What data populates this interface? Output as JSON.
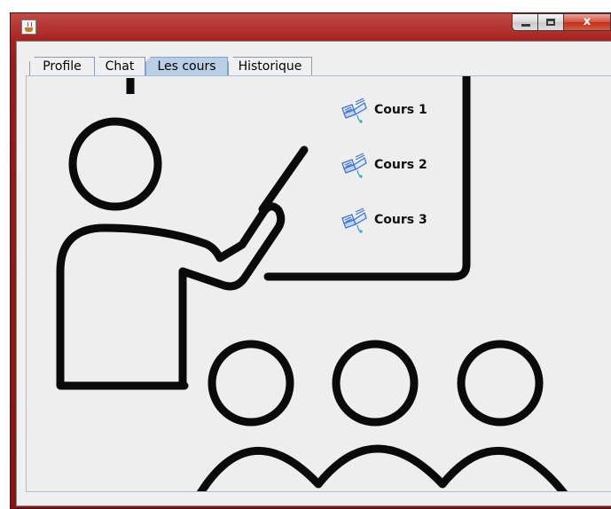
{
  "window": {
    "icon": "java-cup-icon",
    "buttons": [
      "minimize-icon",
      "maximize-icon",
      "close-icon"
    ],
    "close_glyph": "x"
  },
  "tabs": [
    {
      "label": "Profile",
      "selected": false
    },
    {
      "label": "Chat",
      "selected": false
    },
    {
      "label": "Les cours",
      "selected": true
    },
    {
      "label": "Historique",
      "selected": false
    }
  ],
  "courses": [
    {
      "label": "Cours 1",
      "icon": "open-book-icon"
    },
    {
      "label": "Cours 2",
      "icon": "open-book-icon"
    },
    {
      "label": "Cours 3",
      "icon": "open-book-icon"
    }
  ],
  "illustration": "teacher-classroom-illustration",
  "colors": {
    "titlebar": "#a8231f",
    "tab_selected": "#b8cfe5",
    "panel_border": "#a7bcd6",
    "book_icon": "#3b6fd1",
    "drawing": "#0a0a0a"
  }
}
